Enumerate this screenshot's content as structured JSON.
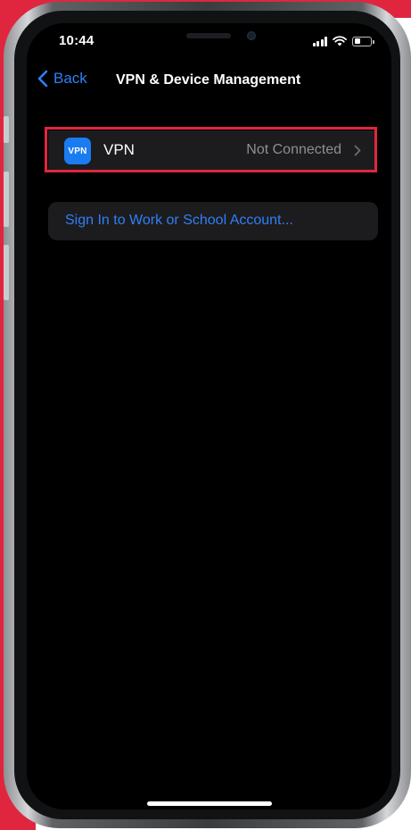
{
  "status_bar": {
    "time": "10:44",
    "icons": [
      "signal-icon",
      "wifi-icon",
      "battery-icon"
    ],
    "battery_level_percent": 40
  },
  "nav": {
    "back_label": "Back",
    "back_icon": "chevron-left-icon",
    "title": "VPN & Device Management"
  },
  "vpn_row": {
    "badge_text": "VPN",
    "label": "VPN",
    "status": "Not Connected",
    "icon": "chevron-right-icon",
    "highlighted": true
  },
  "account_row": {
    "label": "Sign In to Work or School Account..."
  },
  "colors": {
    "accent": "#2f7ff7",
    "highlight": "#e0263f",
    "row_background": "#1c1c1e",
    "screen_background": "#000000",
    "badge_background": "#1a7cf0"
  }
}
